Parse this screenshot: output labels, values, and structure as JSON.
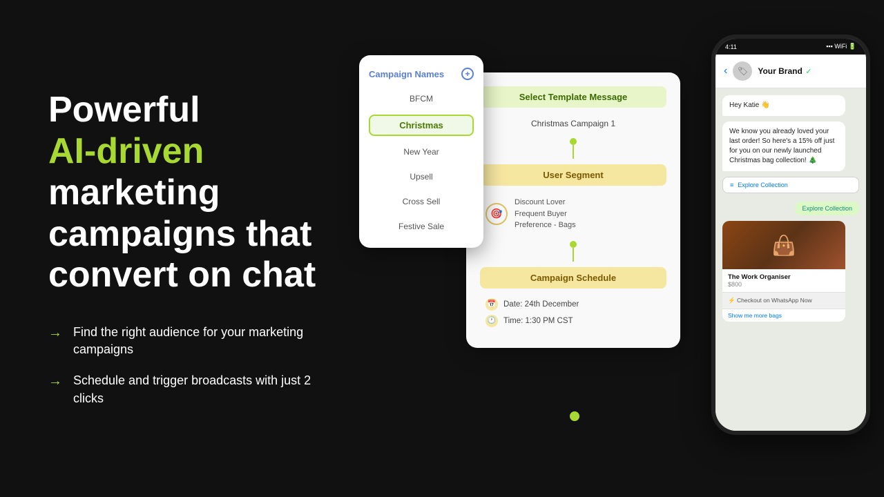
{
  "background": "#111111",
  "headline": {
    "line1": "Powerful",
    "line2": "AI-driven",
    "line3": "marketing",
    "line4": "campaigns that",
    "line5": "convert on chat"
  },
  "bullets": [
    {
      "text": "Find the right audience for your marketing campaigns"
    },
    {
      "text": "Schedule and trigger broadcasts with just 2 clicks"
    }
  ],
  "campaign_card": {
    "title": "Campaign Names",
    "add_btn": "+",
    "items": [
      {
        "name": "BFCM",
        "active": false
      },
      {
        "name": "Christmas",
        "active": true
      },
      {
        "name": "New Year",
        "active": false
      },
      {
        "name": "Upsell",
        "active": false
      },
      {
        "name": "Cross Sell",
        "active": false
      },
      {
        "name": "Festive Sale",
        "active": false
      }
    ]
  },
  "flow_card": {
    "select_template": {
      "title": "Select Template Message",
      "value": "Christmas Campaign 1"
    },
    "user_segment": {
      "title": "User Segment",
      "tags": [
        "Discount Lover",
        "Frequent Buyer",
        "Preference - Bags"
      ]
    },
    "campaign_schedule": {
      "title": "Campaign Schedule",
      "date": "Date: 24th December",
      "time": "Time: 1:30 PM CST"
    }
  },
  "phone": {
    "status_time": "4:11",
    "brand_name": "Your Brand",
    "verified": "✓",
    "messages": [
      {
        "type": "received",
        "text": "Hey Katie 👋"
      },
      {
        "type": "received",
        "text": "We know you already loved your last order! So here's a 15% off just for you on our newly launched Christmas bag collection! 🎄"
      },
      {
        "type": "explore_btn",
        "text": "Explore Collection"
      },
      {
        "type": "explore_green",
        "text": "Explore Collection"
      },
      {
        "type": "product",
        "name": "The Work Organiser",
        "price": "$800"
      },
      {
        "type": "checkout",
        "text": "⚡ Checkout on WhatsApp Now"
      },
      {
        "type": "show_more",
        "text": "Show me more bags"
      }
    ]
  },
  "accent_color": "#a8d832",
  "blue_color": "#5a7fd4"
}
